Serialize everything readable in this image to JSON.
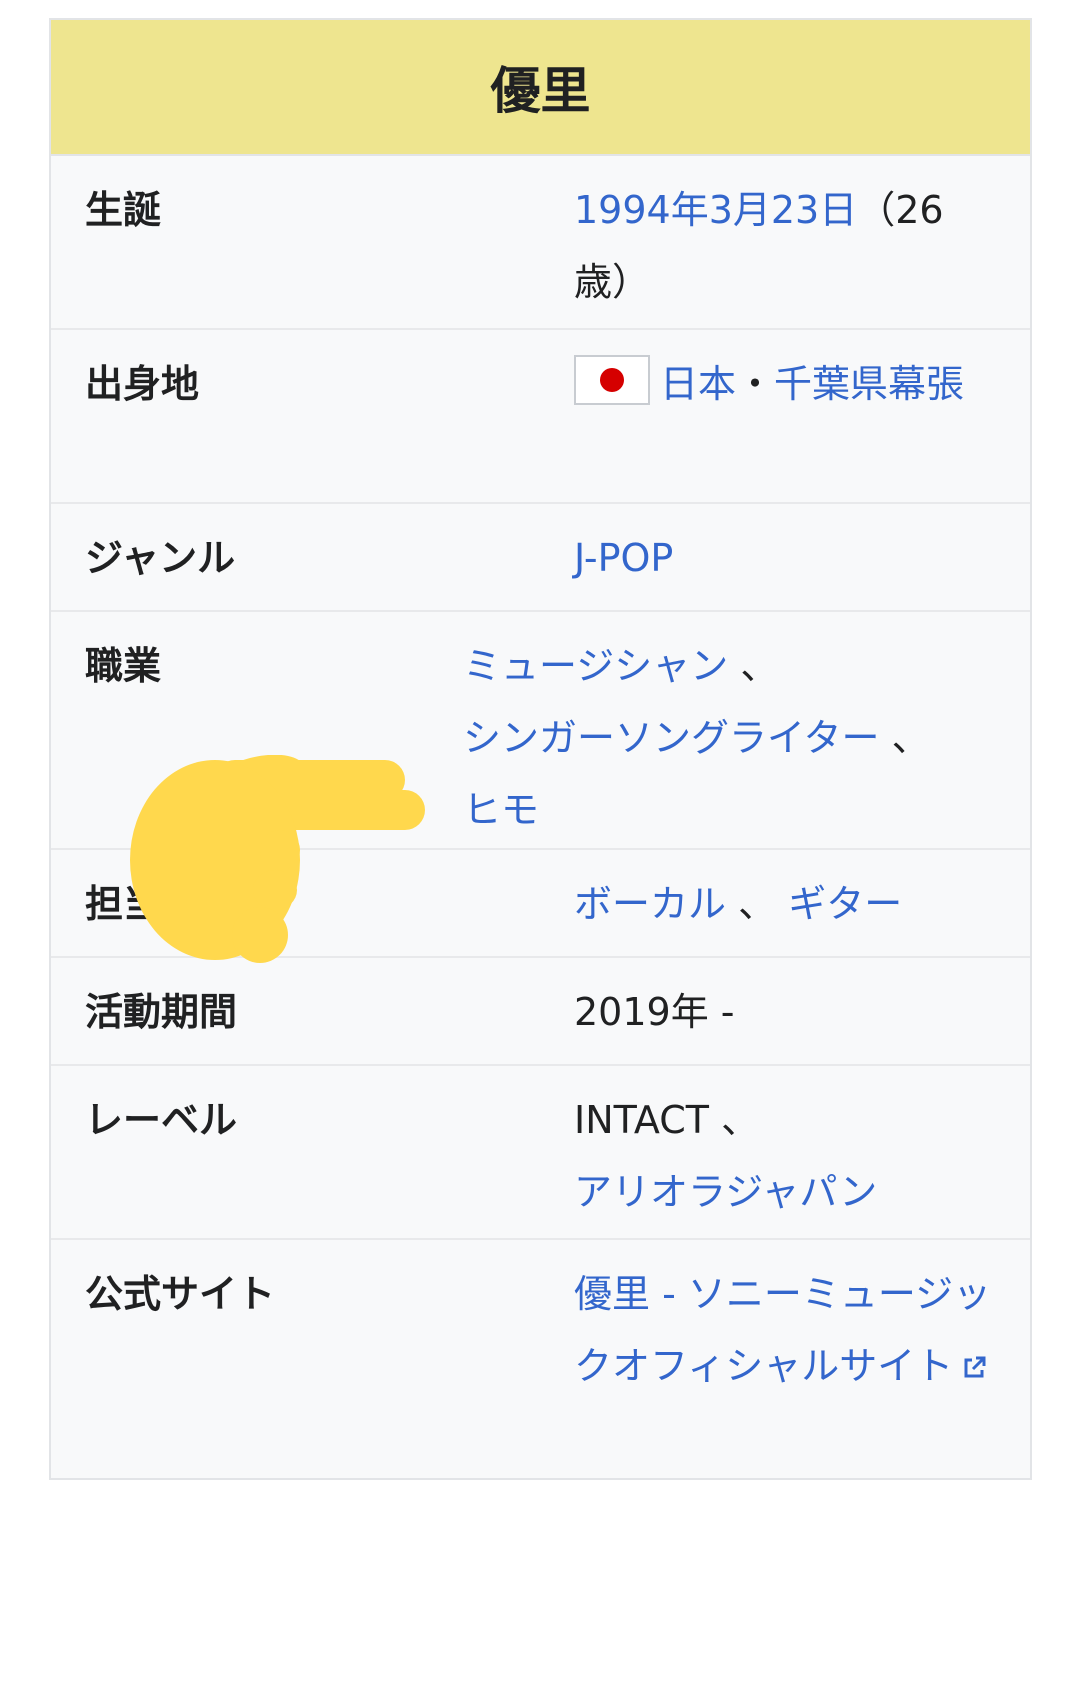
{
  "infobox": {
    "title": "優里",
    "rows": [
      {
        "label": "生誕",
        "date_link": "1994年3月23日",
        "age_text": "（26歳）"
      },
      {
        "label": "出身地",
        "country": "日本",
        "separator": "・",
        "place": "千葉県幕張"
      },
      {
        "label": "ジャンル",
        "genre": "J-POP"
      },
      {
        "label": "職業",
        "job1": "ミュージシャン",
        "sep": "、",
        "job2": "シンガーソングライター",
        "sep2": "、",
        "job3": "ヒモ"
      },
      {
        "label": "担当楽器",
        "inst1": "ボーカル",
        "sep": "、",
        "inst2": "ギター"
      },
      {
        "label": "活動期間",
        "period": "2019年 -"
      },
      {
        "label": "レーベル",
        "label1": "INTACT",
        "sep": "、",
        "label2": "アリオラジャパン"
      },
      {
        "label": "公式サイト",
        "site": "優里 - ソニーミュージックオフィシャルサイト"
      }
    ]
  },
  "colors": {
    "title_bg": "#eee58f",
    "link": "#3366cc",
    "hand": "#ffd84d"
  },
  "icons": {
    "flag": "japan-flag-icon",
    "external": "external-link-icon",
    "hand": "pointing-hand-sticker"
  }
}
